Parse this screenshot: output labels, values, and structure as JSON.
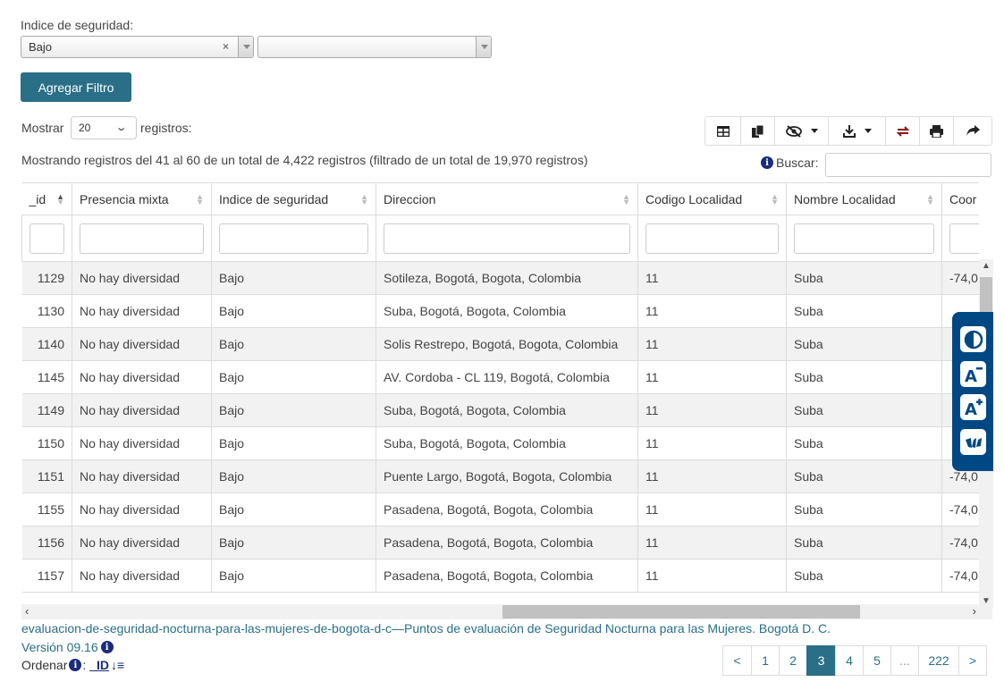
{
  "filter": {
    "label": "Indice de seguridad:",
    "select_value": "Bajo",
    "clear_symbol": "×",
    "second_select_value": "",
    "add_button": "Agregar Filtro"
  },
  "length": {
    "show_label": "Mostrar",
    "value": "20",
    "records_label": "registros:"
  },
  "info": "Mostrando registros del 41 al 60 de un total de 4,422 registros (filtrado de un total de 19,970 registros)",
  "search": {
    "label": "Buscar:",
    "value": ""
  },
  "toolbar": {
    "icons": [
      "table-icon",
      "copy-icon",
      "column-visibility-icon",
      "download-icon",
      "refresh-icon",
      "print-icon",
      "share-icon"
    ]
  },
  "table": {
    "columns": [
      "_id",
      "Presencia mixta",
      "Indice de seguridad",
      "Direccion",
      "Codigo Localidad",
      "Nombre Localidad",
      "Coor"
    ],
    "rows": [
      [
        "1129",
        "No hay diversidad",
        "Bajo",
        "Sotileza, Bogotá, Bogota, Colombia",
        "11",
        "Suba",
        "-74,0"
      ],
      [
        "1130",
        "No hay diversidad",
        "Bajo",
        "Suba, Bogotá, Bogota, Colombia",
        "11",
        "Suba",
        ""
      ],
      [
        "1140",
        "No hay diversidad",
        "Bajo",
        "Solis Restrepo, Bogotá, Bogota, Colombia",
        "11",
        "Suba",
        ""
      ],
      [
        "1145",
        "No hay diversidad",
        "Bajo",
        "AV. Cordoba - CL 119, Bogotá, Colombia",
        "11",
        "Suba",
        ""
      ],
      [
        "1149",
        "No hay diversidad",
        "Bajo",
        "Suba, Bogotá, Bogota, Colombia",
        "11",
        "Suba",
        ""
      ],
      [
        "1150",
        "No hay diversidad",
        "Bajo",
        "Suba, Bogotá, Bogota, Colombia",
        "11",
        "Suba",
        ""
      ],
      [
        "1151",
        "No hay diversidad",
        "Bajo",
        "Puente Largo, Bogotá, Bogota, Colombia",
        "11",
        "Suba",
        "-74,0"
      ],
      [
        "1155",
        "No hay diversidad",
        "Bajo",
        "Pasadena, Bogotá, Bogota, Colombia",
        "11",
        "Suba",
        "-74,0"
      ],
      [
        "1156",
        "No hay diversidad",
        "Bajo",
        "Pasadena, Bogotá, Bogota, Colombia",
        "11",
        "Suba",
        "-74,0"
      ],
      [
        "1157",
        "No hay diversidad",
        "Bajo",
        "Pasadena, Bogotá, Bogota, Colombia",
        "11",
        "Suba",
        "-74,0"
      ]
    ]
  },
  "accessibility": {
    "buttons": [
      "contrast-icon",
      "decrease-text-icon",
      "increase-text-icon",
      "sign-language-icon"
    ]
  },
  "footer": {
    "dataset_link": "evaluacion-de-seguridad-nocturna-para-las-mujeres-de-bogota-d-c—Puntos de evaluación de Seguridad Nocturna para las Mujeres. Bogotá D. C.",
    "version": "Versión 09.16",
    "order_label": "Ordenar",
    "order_colon": ":",
    "order_field": "_ID"
  },
  "pagination": {
    "prev": "<",
    "pages": [
      "1",
      "2",
      "3",
      "4",
      "5",
      "...",
      "222"
    ],
    "active": "3",
    "next": ">"
  },
  "colors": {
    "accent": "#2a6f87",
    "accessibility_panel": "#004884"
  }
}
